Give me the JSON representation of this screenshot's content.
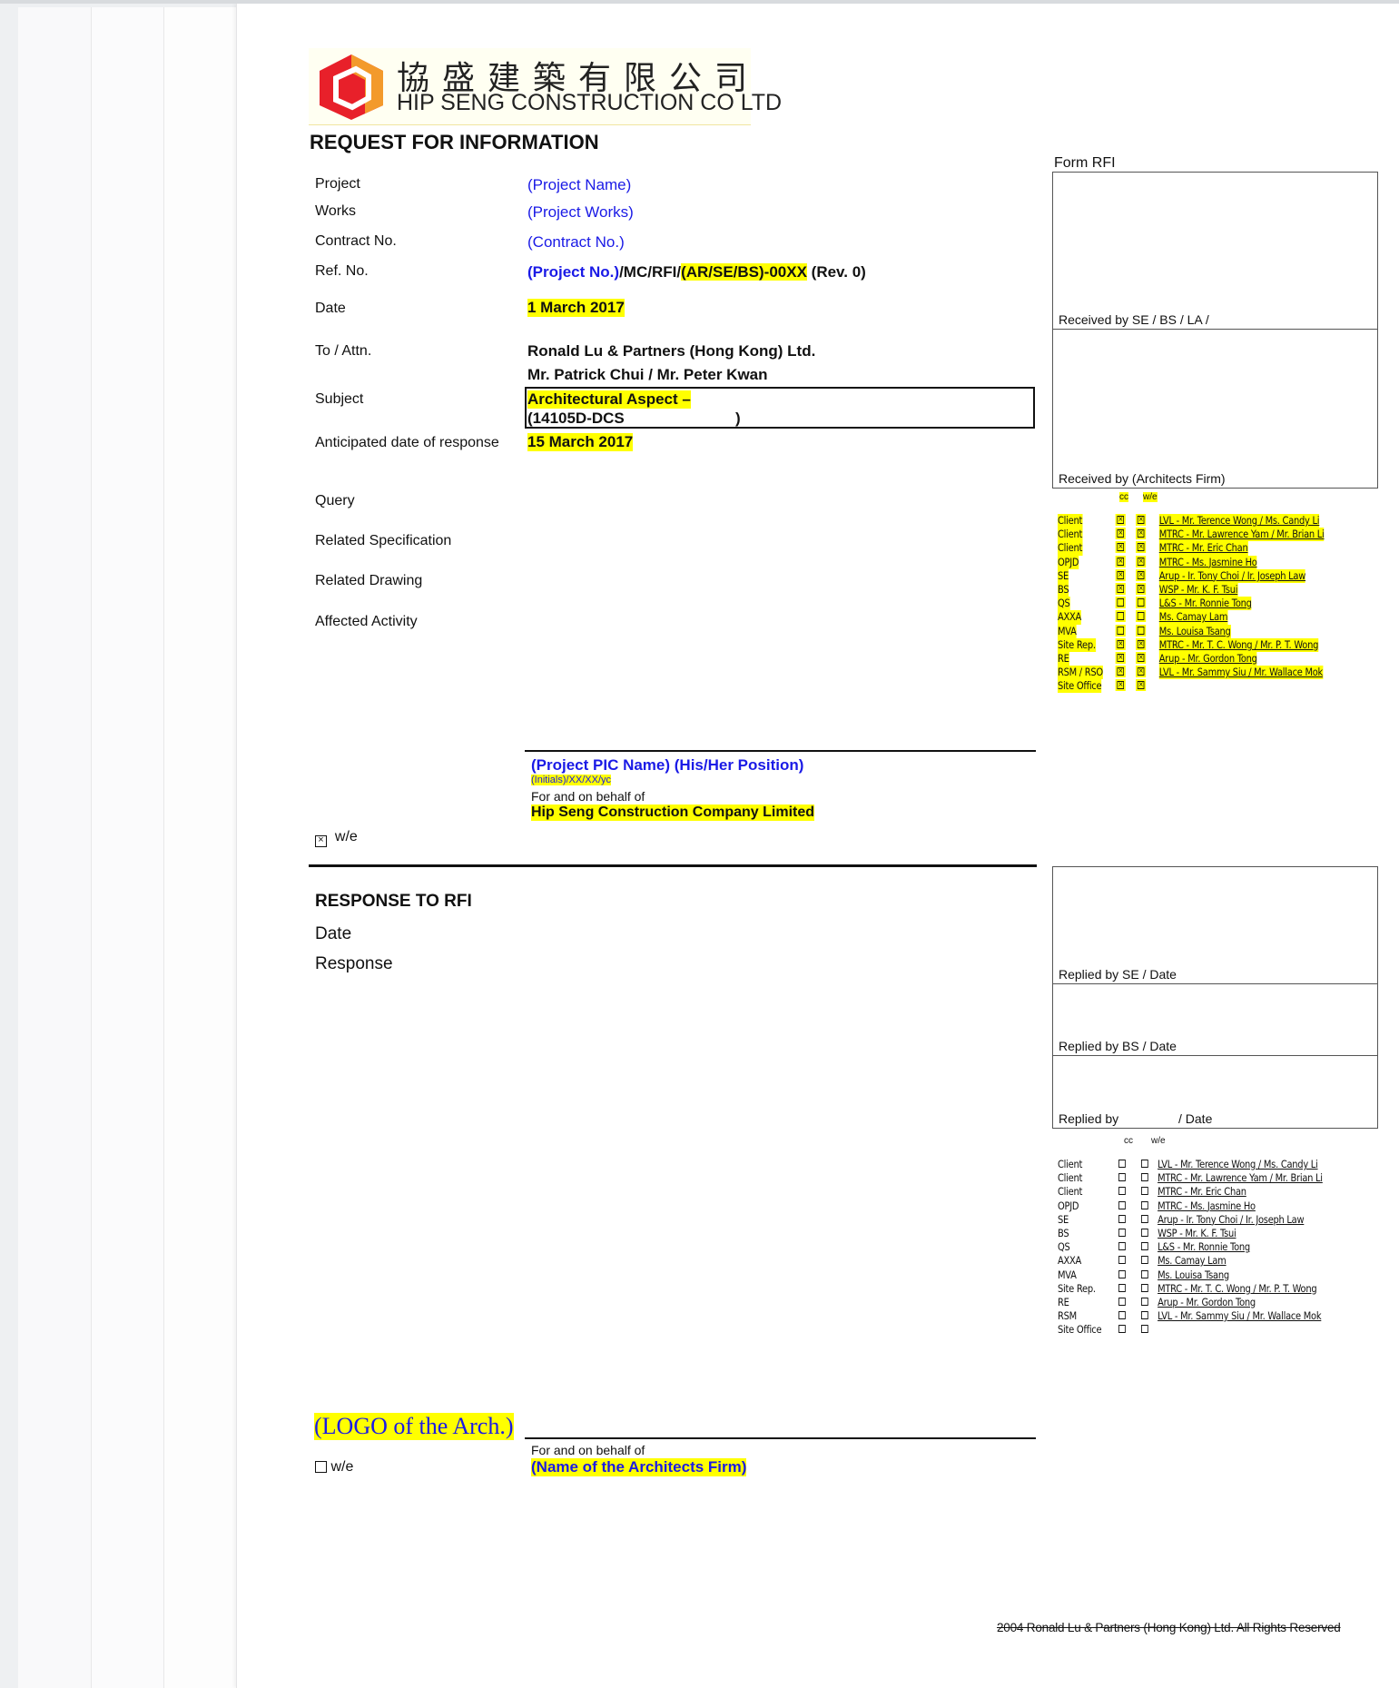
{
  "company": {
    "name_cn": "協盛建築有限公司",
    "name_en": "HIP SENG CONSTRUCTION CO LTD",
    "brand_color": "#e8202a",
    "accent_color": "#f39a2b"
  },
  "form": {
    "title": "REQUEST FOR INFORMATION",
    "form_label": "Form RFI",
    "fields": {
      "project_label": "Project",
      "project_value": "(Project Name)",
      "works_label": "Works",
      "works_value": "(Project Works)",
      "contract_label": "Contract No.",
      "contract_value": "(Contract No.)",
      "ref_label": "Ref. No.",
      "ref_part1": "(Project No.)",
      "ref_part2": "/MC/RFI/",
      "ref_part3": "(AR/SE/BS)-00XX",
      "ref_part4": " (Rev. 0)",
      "date_label": "Date",
      "date_value": "1 March 2017",
      "to_label": "To / Attn.",
      "to_line1": "Ronald Lu & Partners (Hong Kong) Ltd.",
      "to_line2": "Mr. Patrick Chui / Mr. Peter Kwan",
      "subject_label": "Subject",
      "subject_line1": "Architectural Aspect –",
      "subject_line2": "(14105D-DCS",
      "subject_close": ")",
      "anticipated_label": "Anticipated date of response",
      "anticipated_value": "15 March 2017",
      "query_label": "Query",
      "spec_label": "Related Specification",
      "drawing_label": "Related Drawing",
      "activity_label": "Affected Activity"
    },
    "signature": {
      "name_position": "(Project PIC Name) (His/Her Position)",
      "initials": "(Initials)/XX/XX/yc",
      "behalf": "For and on behalf of",
      "company": "Hip Seng Construction Company Limited"
    },
    "we_label": "w/e",
    "received_se": "Received by SE / BS / LA /",
    "received_arch": "Received by (Architects Firm)"
  },
  "response": {
    "title": "RESPONSE TO RFI",
    "date_label": "Date",
    "response_label": "Response",
    "replied_se": "Replied by SE / Date",
    "replied_bs": "Replied by BS / Date",
    "replied_by": "Replied by",
    "replied_date": "/ Date",
    "arch_logo": "(LOGO of the Arch.)",
    "behalf": "For and on behalf of",
    "firm": "(Name of the Architects Firm)",
    "we_label": "w/e"
  },
  "distribution_headers": {
    "cc": "cc",
    "we": "w/e"
  },
  "distribution_top": [
    {
      "who": "Client",
      "name": "LVL - Mr. Terence Wong / Ms. Candy Li",
      "cc": true,
      "we": true
    },
    {
      "who": "Client",
      "name": "MTRC - Mr. Lawrence Yam / Mr. Brian Li",
      "cc": true,
      "we": true
    },
    {
      "who": "Client",
      "name": "MTRC - Mr. Eric Chan",
      "cc": true,
      "we": true
    },
    {
      "who": "OPJD",
      "name": "MTRC - Ms. Jasmine Ho",
      "cc": true,
      "we": true
    },
    {
      "who": "SE",
      "name": "Arup - Ir. Tony Choi / Ir. Joseph Law",
      "cc": true,
      "we": true
    },
    {
      "who": "BS",
      "name": "WSP - Mr. K. F. Tsui",
      "cc": true,
      "we": true
    },
    {
      "who": "QS",
      "name": "L&S - Mr. Ronnie Tong",
      "cc": false,
      "we": false
    },
    {
      "who": "AXXA",
      "name": "Ms. Camay Lam",
      "cc": false,
      "we": false
    },
    {
      "who": "MVA",
      "name": "Ms. Louisa Tsang",
      "cc": false,
      "we": false
    },
    {
      "who": "Site Rep.",
      "name": "MTRC - Mr. T. C. Wong / Mr. P. T. Wong",
      "cc": true,
      "we": true
    },
    {
      "who": "RE",
      "name": "Arup - Mr. Gordon Tong",
      "cc": true,
      "we": true
    },
    {
      "who": "RSM / RSO",
      "name": "LVL - Mr. Sammy Siu / Mr. Wallace Mok",
      "cc": true,
      "we": true
    },
    {
      "who": "Site Office",
      "name": "",
      "cc": true,
      "we": true
    }
  ],
  "distribution_bottom": [
    {
      "who": "Client",
      "name": "LVL - Mr. Terence Wong / Ms. Candy Li"
    },
    {
      "who": "Client",
      "name": "MTRC - Mr. Lawrence Yam / Mr. Brian Li"
    },
    {
      "who": "Client",
      "name": "MTRC - Mr. Eric Chan"
    },
    {
      "who": "OPJD",
      "name": "MTRC - Ms. Jasmine Ho"
    },
    {
      "who": "SE",
      "name": "Arup - Ir. Tony Choi / Ir. Joseph Law"
    },
    {
      "who": "BS",
      "name": "WSP - Mr. K. F. Tsui"
    },
    {
      "who": "QS",
      "name": "L&S - Mr. Ronnie Tong"
    },
    {
      "who": "AXXA",
      "name": "Ms. Camay Lam"
    },
    {
      "who": "MVA",
      "name": "Ms. Louisa Tsang"
    },
    {
      "who": "Site Rep.",
      "name": "MTRC - Mr. T. C. Wong / Mr. P. T. Wong"
    },
    {
      "who": "RE",
      "name": "Arup - Mr. Gordon Tong"
    },
    {
      "who": "RSM",
      "name": "LVL - Mr. Sammy Siu / Mr. Wallace Mok"
    },
    {
      "who": "Site Office",
      "name": ""
    }
  ],
  "footer": {
    "copyright": "2004 Ronald Lu & Partners (Hong Kong) Ltd. All Rights Reserved"
  }
}
